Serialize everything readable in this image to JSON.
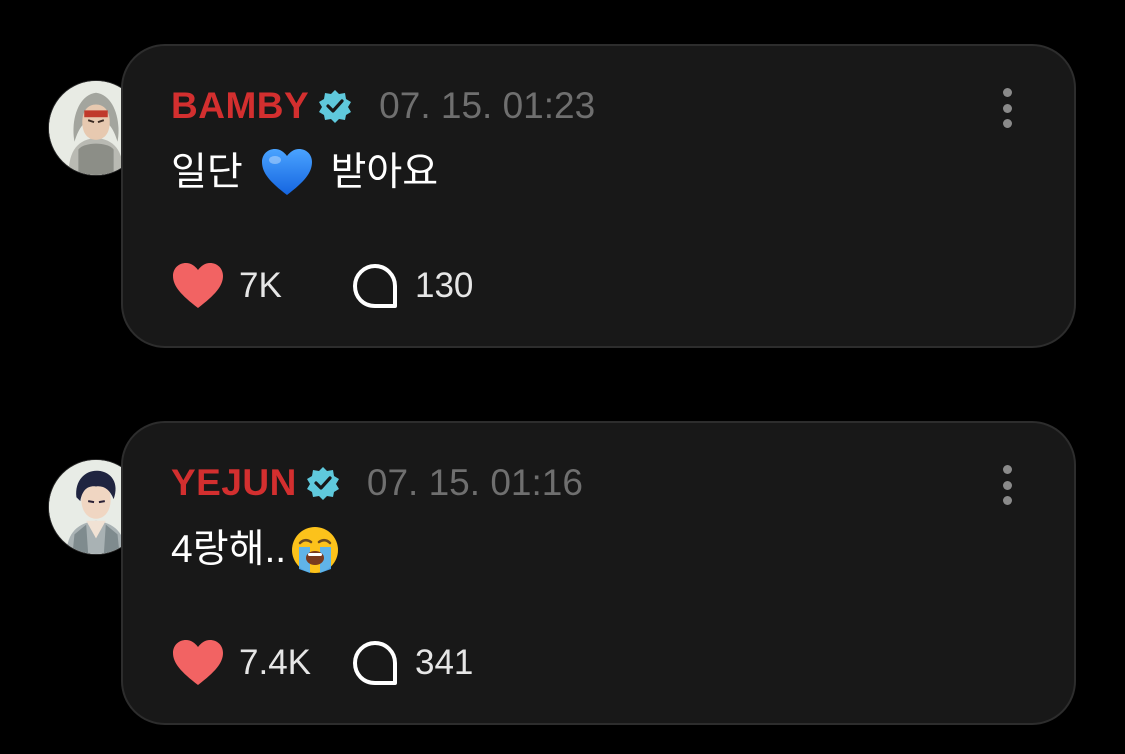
{
  "colors": {
    "background": "#000000",
    "card": "#181818",
    "card_border": "#2d2d2d",
    "username": "#d32f2f",
    "timestamp": "#6f6f6f",
    "verified_badge": "#5fc9dc",
    "heart": "#f26363",
    "text": "#ffffff"
  },
  "posts": [
    {
      "username": "BAMBY",
      "verified": true,
      "timestamp": "07. 15. 01:23",
      "text_before_emoji": "일단 ",
      "emoji": "blue-heart",
      "text_after_emoji": " 받아요",
      "likes": "7K",
      "replies": "130"
    },
    {
      "username": "YEJUN",
      "verified": true,
      "timestamp": "07. 15. 01:16",
      "text_before_emoji": "4랑해..",
      "emoji": "loudly-crying-face",
      "text_after_emoji": "",
      "likes": "7.4K",
      "replies": "341"
    }
  ],
  "icons": {
    "like": "heart-icon",
    "reply": "speech-bubble-icon",
    "more": "more-vertical-icon",
    "verified": "verified-badge-icon"
  }
}
